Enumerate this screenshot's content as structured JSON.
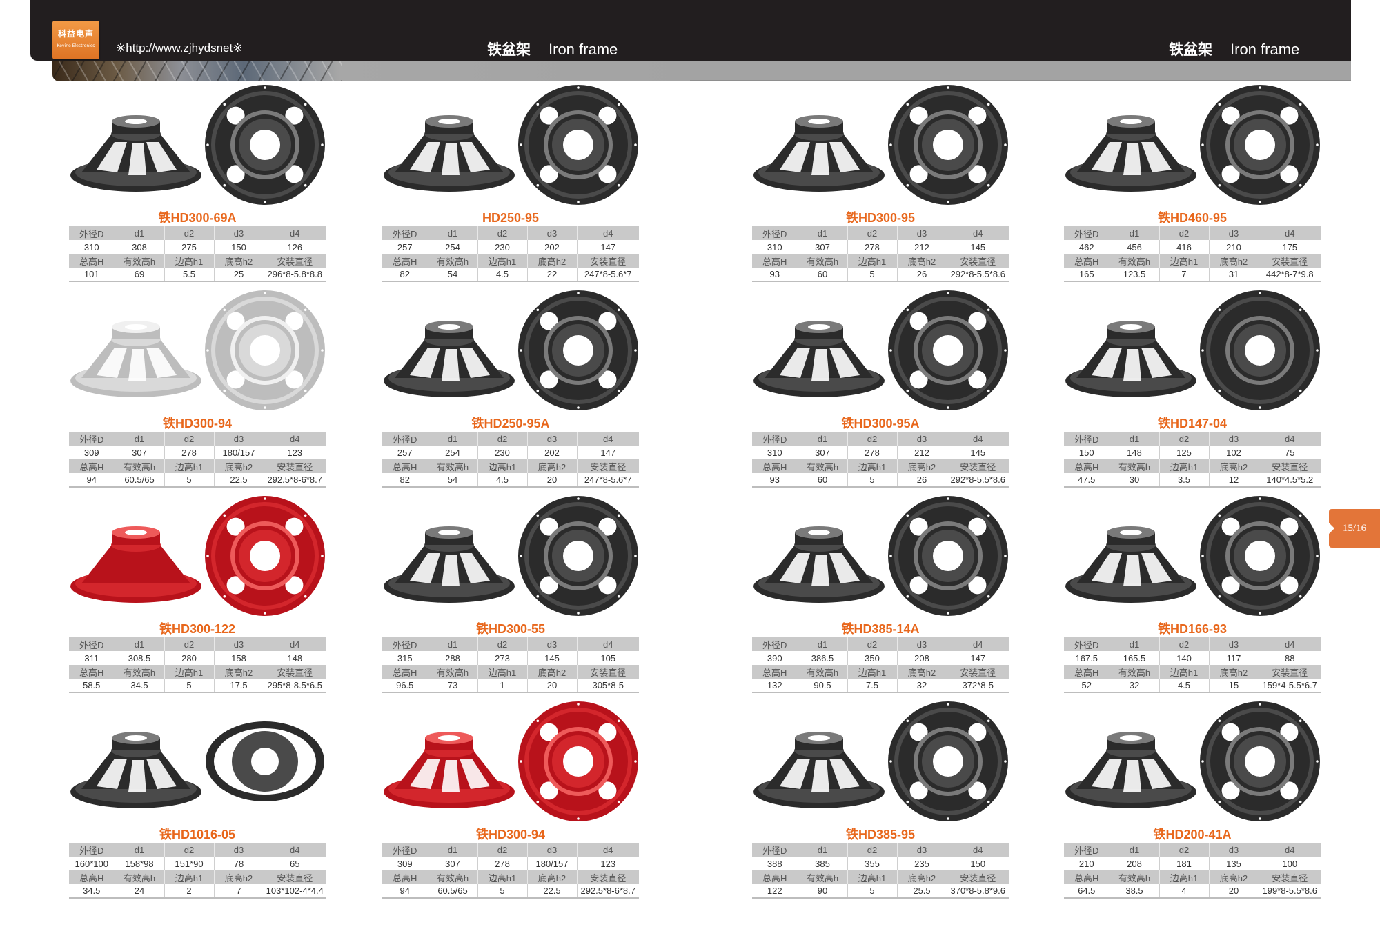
{
  "header": {
    "logo_cn": "科益电声",
    "logo_en": "Keyine Electronics",
    "url": "※http://www.zjhydsnet※",
    "left_title_cn": "铁盆架",
    "left_title_en": "Iron frame",
    "right_title_cn": "铁盆架",
    "right_title_en": "Iron frame"
  },
  "page_indicator": "15/16",
  "table_labels": {
    "row1": [
      "外径D",
      "d1",
      "d2",
      "d3",
      "d4"
    ],
    "row2": [
      "总高H",
      "有效高h",
      "边高h1",
      "底高h2",
      "安装直径"
    ]
  },
  "colors": {
    "accent": "#e8671c",
    "header_bg": "#221e1f",
    "tab": "#e37539"
  },
  "products": [
    {
      "name": "铁HD300-69A",
      "finish": "black",
      "style": "4-window",
      "v1": [
        "310",
        "308",
        "275",
        "150",
        "126"
      ],
      "v2": [
        "101",
        "69",
        "5.5",
        "25",
        "296*8-5.8*8.8"
      ]
    },
    {
      "name": "HD250-95",
      "finish": "black",
      "style": "ribbed",
      "v1": [
        "257",
        "254",
        "230",
        "202",
        "147"
      ],
      "v2": [
        "82",
        "54",
        "4.5",
        "22",
        "247*8-5.6*7"
      ]
    },
    {
      "name": "铁HD300-95",
      "finish": "black",
      "style": "ribbed",
      "v1": [
        "310",
        "307",
        "278",
        "212",
        "145"
      ],
      "v2": [
        "93",
        "60",
        "5",
        "26",
        "292*8-5.5*8.6"
      ]
    },
    {
      "name": "铁HD460-95",
      "finish": "black",
      "style": "4-window",
      "v1": [
        "462",
        "456",
        "416",
        "210",
        "175"
      ],
      "v2": [
        "165",
        "123.5",
        "7",
        "31",
        "442*8-7*9.8"
      ]
    },
    {
      "name": "铁HD300-94",
      "finish": "silver",
      "style": "4-window",
      "v1": [
        "309",
        "307",
        "278",
        "180/157",
        "123"
      ],
      "v2": [
        "94",
        "60.5/65",
        "5",
        "22.5",
        "292.5*8-6*8.7"
      ]
    },
    {
      "name": "铁HD250-95A",
      "finish": "black",
      "style": "ribbed",
      "v1": [
        "257",
        "254",
        "230",
        "202",
        "147"
      ],
      "v2": [
        "82",
        "54",
        "4.5",
        "20",
        "247*8-5.6*7"
      ]
    },
    {
      "name": "铁HD300-95A",
      "finish": "black",
      "style": "ribbed",
      "v1": [
        "310",
        "307",
        "278",
        "212",
        "145"
      ],
      "v2": [
        "93",
        "60",
        "5",
        "26",
        "292*8-5.5*8.6"
      ]
    },
    {
      "name": "铁HD147-04",
      "finish": "black",
      "style": "solid",
      "v1": [
        "150",
        "148",
        "125",
        "102",
        "75"
      ],
      "v2": [
        "47.5",
        "30",
        "3.5",
        "12",
        "140*4.5*5.2"
      ]
    },
    {
      "name": "铁HD300-122",
      "finish": "red",
      "style": "flat",
      "v1": [
        "311",
        "308.5",
        "280",
        "158",
        "148"
      ],
      "v2": [
        "58.5",
        "34.5",
        "5",
        "17.5",
        "295*8-8.5*6.5"
      ]
    },
    {
      "name": "铁HD300-55",
      "finish": "black",
      "style": "spoke",
      "v1": [
        "315",
        "288",
        "273",
        "145",
        "105"
      ],
      "v2": [
        "96.5",
        "73",
        "1",
        "20",
        "305*8-5"
      ]
    },
    {
      "name": "铁HD385-14A",
      "finish": "black",
      "style": "star",
      "v1": [
        "390",
        "386.5",
        "350",
        "208",
        "147"
      ],
      "v2": [
        "132",
        "90.5",
        "7.5",
        "32",
        "372*8-5"
      ]
    },
    {
      "name": "铁HD166-93",
      "finish": "black",
      "style": "ribbed",
      "v1": [
        "167.5",
        "165.5",
        "140",
        "117",
        "88"
      ],
      "v2": [
        "52",
        "32",
        "4.5",
        "15",
        "159*4-5.5*6.7"
      ]
    },
    {
      "name": "铁HD1016-05",
      "finish": "black",
      "style": "oval",
      "v1": [
        "160*100",
        "158*98",
        "151*90",
        "78",
        "65"
      ],
      "v2": [
        "34.5",
        "24",
        "2",
        "7",
        "103*102-4*4.4"
      ]
    },
    {
      "name": "铁HD300-94",
      "finish": "red",
      "style": "4-window",
      "v1": [
        "309",
        "307",
        "278",
        "180/157",
        "123"
      ],
      "v2": [
        "94",
        "60.5/65",
        "5",
        "22.5",
        "292.5*8-6*8.7"
      ]
    },
    {
      "name": "铁HD385-95",
      "finish": "black",
      "style": "ribbed",
      "v1": [
        "388",
        "385",
        "355",
        "235",
        "150"
      ],
      "v2": [
        "122",
        "90",
        "5",
        "25.5",
        "370*8-5.8*9.6"
      ]
    },
    {
      "name": "铁HD200-41A",
      "finish": "black",
      "style": "4-window",
      "v1": [
        "210",
        "208",
        "181",
        "135",
        "100"
      ],
      "v2": [
        "64.5",
        "38.5",
        "4",
        "20",
        "199*8-5.5*8.6"
      ]
    }
  ]
}
